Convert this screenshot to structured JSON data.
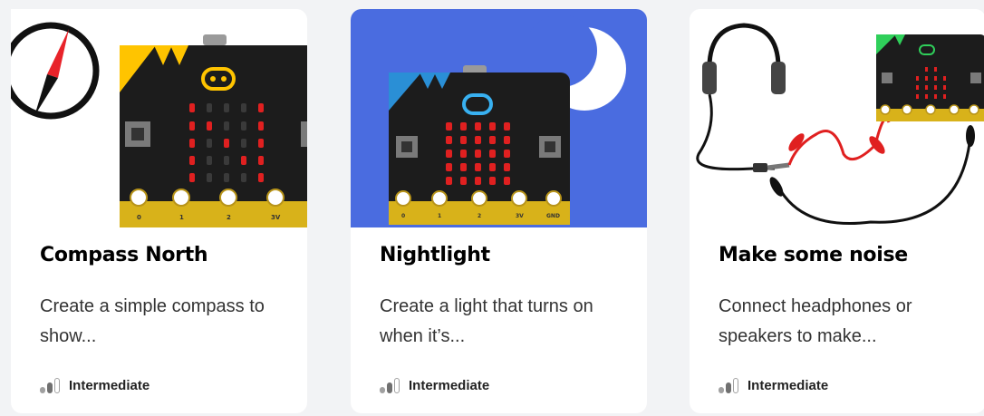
{
  "cards": [
    {
      "title": "Compass North",
      "description": "Create a simple compass to show...",
      "level": "Intermediate",
      "level_value": 2,
      "level_max": 3,
      "image": "compass-microbit-illustration",
      "accent": "#ffc400"
    },
    {
      "title": "Nightlight",
      "description": "Create a light that turns on when it’s...",
      "level": "Intermediate",
      "level_value": 2,
      "level_max": 3,
      "image": "nightlight-microbit-illustration",
      "accent": "#4a6ce0"
    },
    {
      "title": "Make some noise",
      "description": "Connect headphones or speakers to make...",
      "level": "Intermediate",
      "level_value": 2,
      "level_max": 3,
      "image": "headphones-microbit-illustration",
      "accent": "#2fcf5a"
    }
  ],
  "microbit_pin_labels": [
    "0",
    "1",
    "2",
    "3V",
    "GND"
  ]
}
